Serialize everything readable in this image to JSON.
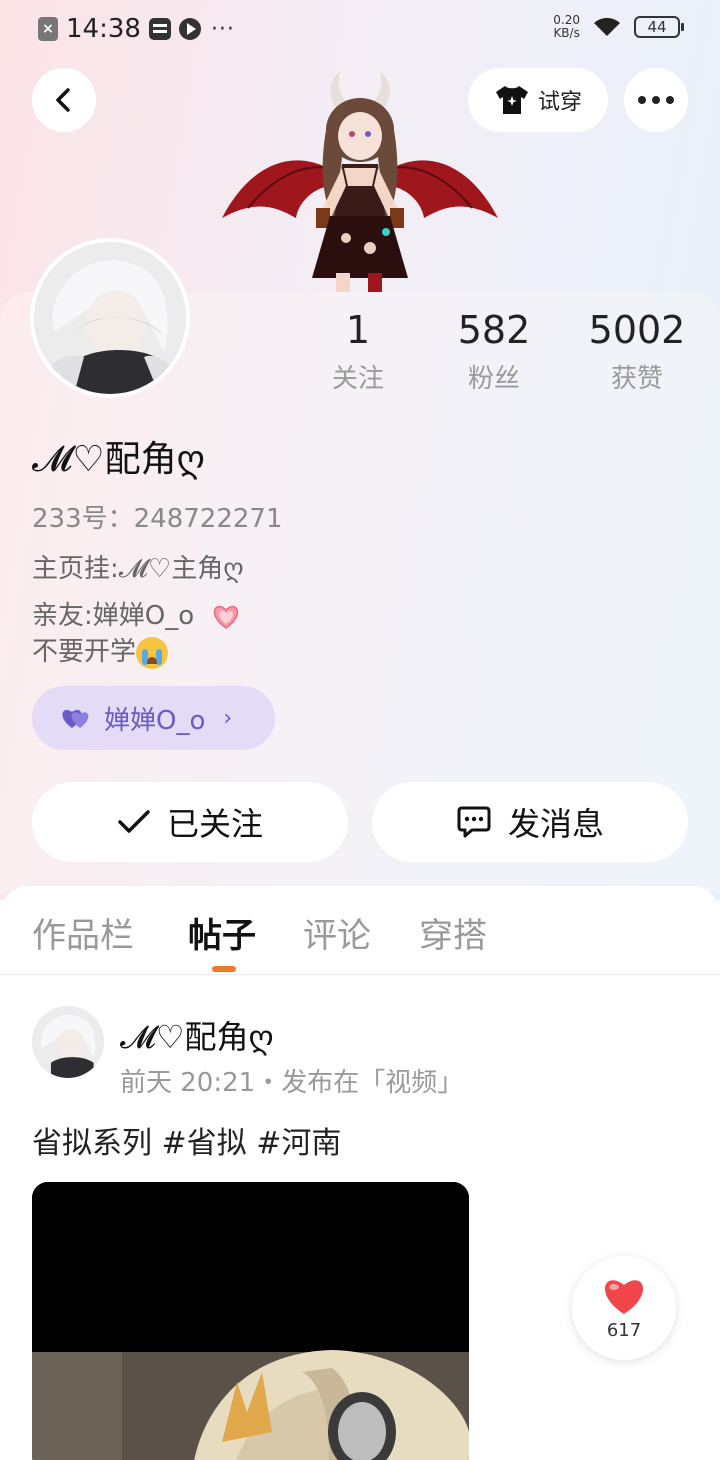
{
  "status_bar": {
    "time": "14:38",
    "more": "···",
    "net_speed_value": "0.20",
    "net_speed_unit": "KB/s",
    "battery": "44"
  },
  "header": {
    "tryon_label": "试穿"
  },
  "profile": {
    "stats": [
      {
        "value": "1",
        "label": "关注"
      },
      {
        "value": "582",
        "label": "粉丝"
      },
      {
        "value": "5002",
        "label": "获赞"
      }
    ],
    "username": "𝓜♡配角ღ",
    "uid_label": "233号：",
    "uid": "248722271",
    "bio_line1": "主页挂:𝓜♡主角ღ",
    "bio_line2": "亲友:婵婵O_o",
    "bio_line3": "不要开学",
    "friend_pill_label": "婵婵O_o",
    "follow_label": "已关注",
    "message_label": "发消息"
  },
  "tabs": [
    {
      "label": "作品栏"
    },
    {
      "label": "帖子"
    },
    {
      "label": "评论"
    },
    {
      "label": "穿搭"
    }
  ],
  "post": {
    "user": "𝓜♡配角ღ",
    "meta": "前天 20:21・发布在「视频」",
    "text": "省拟系列  #省拟 #河南",
    "likes": "617"
  },
  "colors": {
    "accent": "#f07a2a",
    "pill_bg": "#e4dcf6",
    "pill_text": "#6a5bc8",
    "like_red": "#f0454a"
  }
}
